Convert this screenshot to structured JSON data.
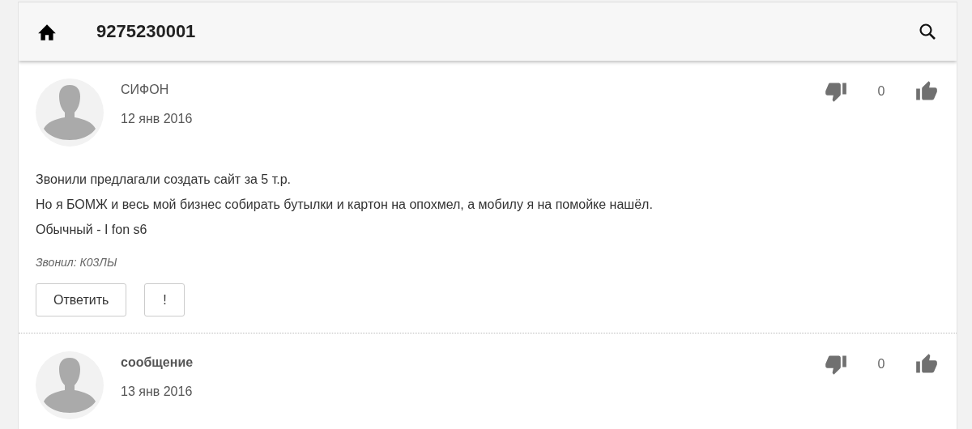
{
  "header": {
    "title": "9275230001"
  },
  "comments": [
    {
      "author": "СИФОН",
      "author_bold": false,
      "date": "12 янв 2016",
      "score": "0",
      "lines": [
        "Звонили предлагали создать сайт за 5 т.р.",
        "Но я БОМЖ и весь мой бизнес собирать бутылки и картон на опохмел, а мобилу я на помойке нашёл.",
        "Обычный - I fon s6"
      ],
      "caller": "Звонил: К03ЛЫ",
      "buttons": [
        "Ответить",
        "!"
      ]
    },
    {
      "author": "сообщение",
      "author_bold": true,
      "date": "13 янв 2016",
      "score": "0"
    }
  ]
}
